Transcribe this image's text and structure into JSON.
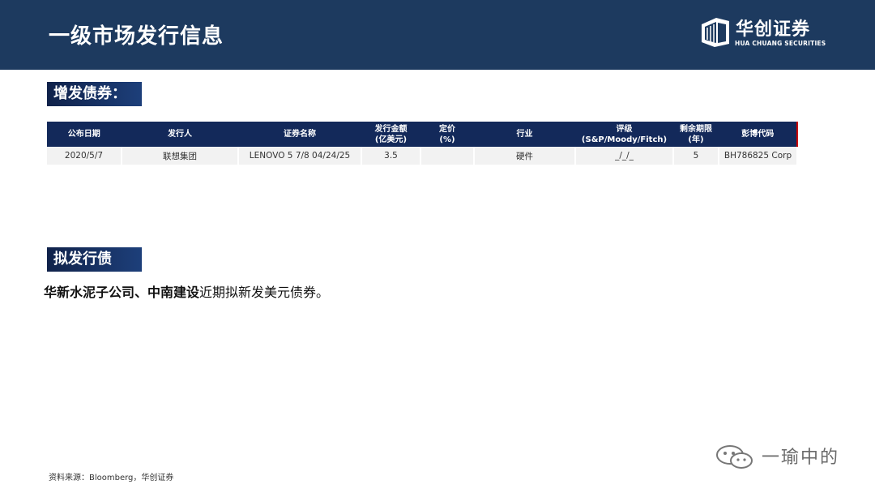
{
  "header": {
    "title": "一级市场发行信息",
    "logo_cn": "华创证券",
    "logo_en": "HUA CHUANG SECURITIES"
  },
  "sections": {
    "new_issue": "增发债券：",
    "planned": "拟发行债券："
  },
  "table": {
    "headers": [
      [
        "公布日期"
      ],
      [
        "发行人"
      ],
      [
        "证券名称"
      ],
      [
        "发行金额",
        "(亿美元)"
      ],
      [
        "定价",
        "(%)"
      ],
      [
        "行业"
      ],
      [
        "评级",
        "(S&P/Moody/Fitch)"
      ],
      [
        "剩余期限",
        "(年)"
      ],
      [
        "彭博代码"
      ]
    ],
    "rows": [
      [
        "2020/5/7",
        "联想集团",
        "LENOVO 5 7/8 04/24/25",
        "3.5",
        "",
        "硬件",
        "_/_/_",
        "5",
        "BH786825 Corp"
      ]
    ]
  },
  "note": {
    "bold": "华新水泥子公司、中南建设",
    "rest": "近期拟新发美元债券。"
  },
  "footer": {
    "source": "资料来源：Bloomberg，华创证券",
    "watermark": "一瑜中的"
  }
}
